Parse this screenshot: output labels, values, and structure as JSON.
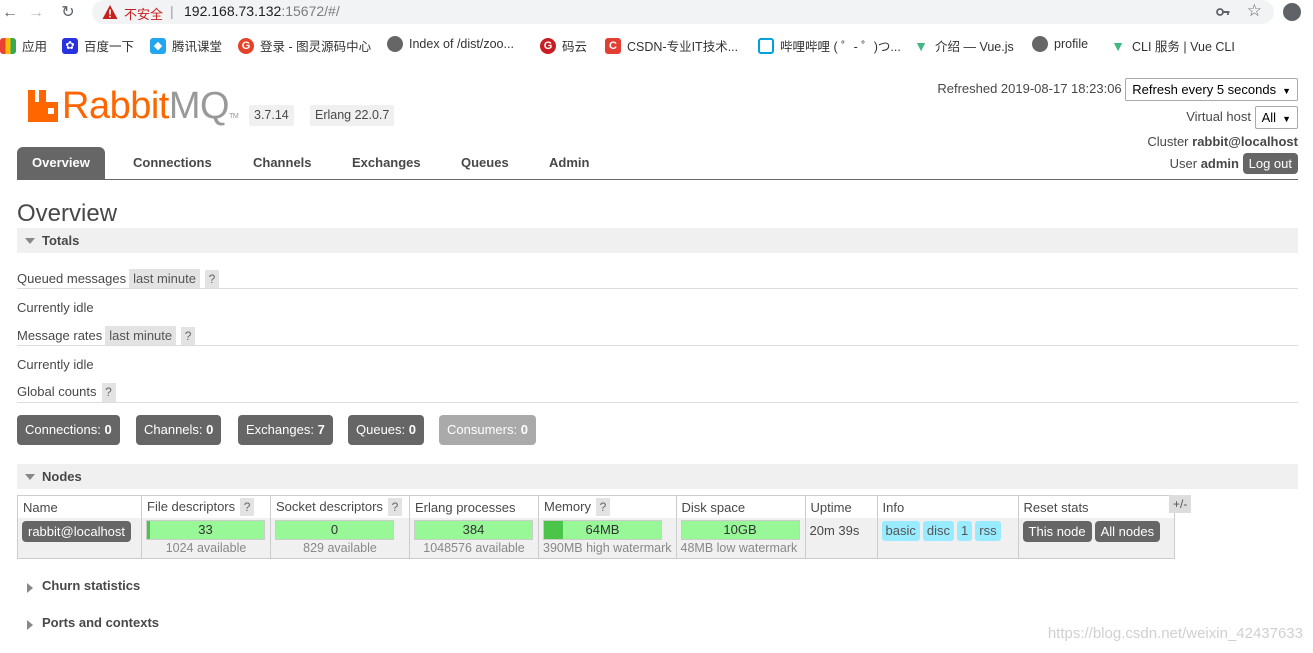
{
  "browser": {
    "insecure_label": "不安全",
    "url_host": "192.168.73.132",
    "url_rest": ":15672/#/",
    "bookmarks": [
      {
        "label": "应用",
        "icon": "apps-grid-icon"
      },
      {
        "label": "百度一下",
        "icon": "baidu-paw-icon"
      },
      {
        "label": "腾讯课堂",
        "icon": "tencent-class-icon"
      },
      {
        "label": "登录 - 图灵源码中心",
        "icon": "gitlab-icon"
      },
      {
        "label": "Index of /dist/zoo...",
        "icon": "globe-icon"
      },
      {
        "label": "码云",
        "icon": "gitee-icon"
      },
      {
        "label": "CSDN-专业IT技术...",
        "icon": "csdn-icon"
      },
      {
        "label": "哔哩哔哩 ( ゜- ゜)つ...",
        "icon": "bilibili-icon"
      },
      {
        "label": "介绍 — Vue.js",
        "icon": "vue-icon"
      },
      {
        "label": "profile",
        "icon": "globe-icon"
      },
      {
        "label": "CLI 服务 | Vue CLI",
        "icon": "vue-icon"
      }
    ]
  },
  "app": {
    "logo_rabbit": "Rabbit",
    "logo_mq": "MQ",
    "logo_tm": "TM",
    "version": "3.7.14",
    "erlang": "Erlang 22.0.7",
    "refreshed_label": "Refreshed 2019-08-17 18:23:06",
    "refresh_select": "Refresh every 5 seconds",
    "vhost_label": "Virtual host",
    "vhost_select": "All",
    "cluster_label": "Cluster",
    "cluster_name": "rabbit@localhost",
    "user_label": "User",
    "user_name": "admin",
    "logout": "Log out"
  },
  "tabs": [
    "Overview",
    "Connections",
    "Channels",
    "Exchanges",
    "Queues",
    "Admin"
  ],
  "page_title": "Overview",
  "totals": {
    "header": "Totals",
    "queued_label": "Queued messages",
    "queued_range": "last minute",
    "help": "?",
    "idle1": "Currently idle",
    "rates_label": "Message rates",
    "rates_range": "last minute",
    "idle2": "Currently idle",
    "global_label": "Global counts",
    "counts": [
      {
        "label": "Connections:",
        "value": "0"
      },
      {
        "label": "Channels:",
        "value": "0"
      },
      {
        "label": "Exchanges:",
        "value": "7"
      },
      {
        "label": "Queues:",
        "value": "0"
      },
      {
        "label": "Consumers:",
        "value": "0"
      }
    ]
  },
  "nodes": {
    "header": "Nodes",
    "columns": [
      "Name",
      "File descriptors",
      "Socket descriptors",
      "Erlang processes",
      "Memory",
      "Disk space",
      "Uptime",
      "Info",
      "Reset stats"
    ],
    "plusminus": "+/-",
    "row": {
      "name": "rabbit@localhost",
      "fd_value": "33",
      "fd_sub": "1024 available",
      "sd_value": "0",
      "sd_sub": "829 available",
      "ep_value": "384",
      "ep_sub": "1048576 available",
      "mem_value": "64MB",
      "mem_sub": "390MB high watermark",
      "mem_fraction": 0.16,
      "disk_value": "10GB",
      "disk_sub": "48MB low watermark",
      "uptime": "20m 39s",
      "info_tags": [
        "basic",
        "disc",
        "1",
        "rss"
      ],
      "reset_this": "This node",
      "reset_all": "All nodes"
    }
  },
  "churn": "Churn statistics",
  "ports": "Ports and contexts",
  "watermark": "https://blog.csdn.net/weixin_42437633"
}
